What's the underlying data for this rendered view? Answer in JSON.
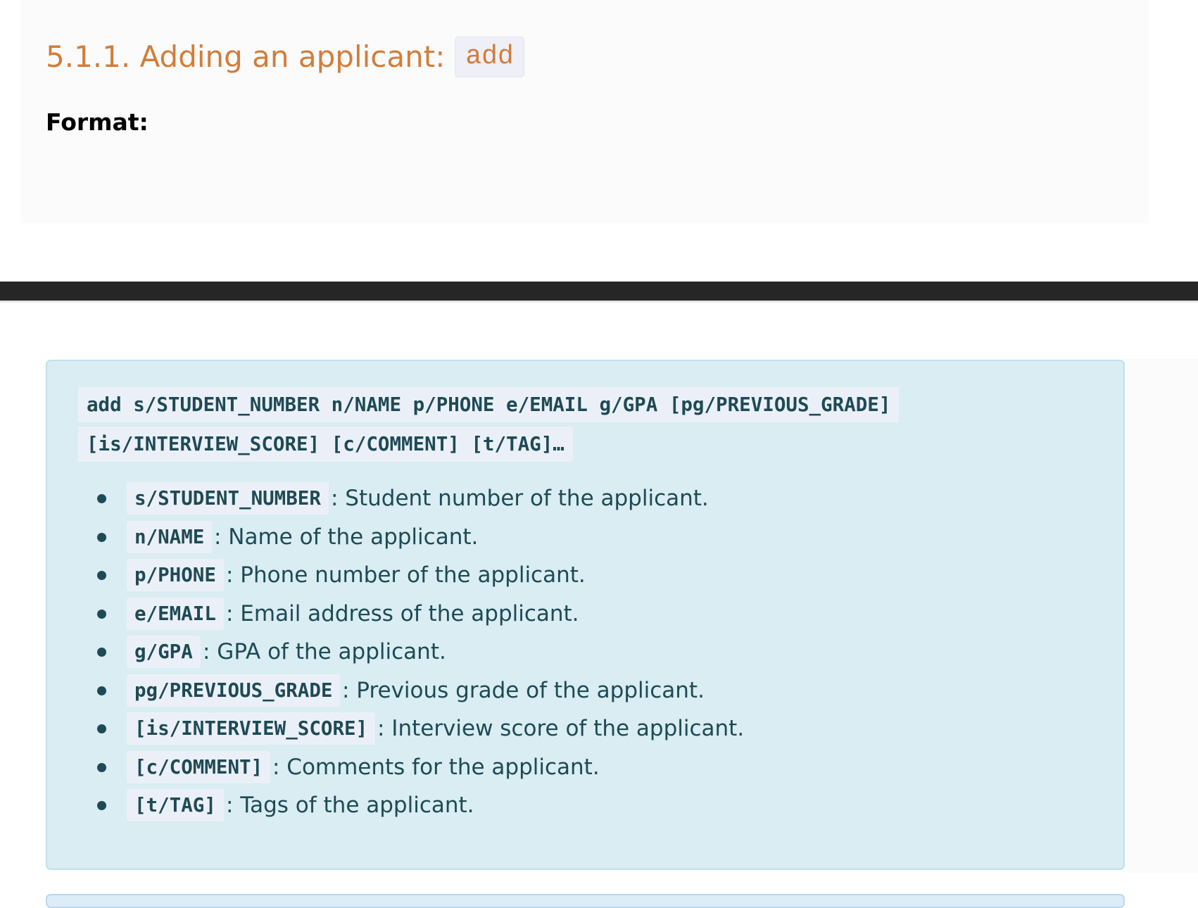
{
  "section": {
    "heading": "5.1.1. Adding an applicant:",
    "command": "add",
    "format_label": "Format:"
  },
  "format_box": {
    "command_line_1": "add s/STUDENT_NUMBER n/NAME p/PHONE e/EMAIL g/GPA [pg/PREVIOUS_GRADE]",
    "command_line_2": "[is/INTERVIEW_SCORE] [c/COMMENT] [t/TAG]…",
    "params": [
      {
        "code": "s/STUDENT_NUMBER",
        "desc": ": Student number of the applicant."
      },
      {
        "code": "n/NAME",
        "desc": ": Name of the applicant."
      },
      {
        "code": "p/PHONE",
        "desc": ": Phone number of the applicant."
      },
      {
        "code": "e/EMAIL",
        "desc": ": Email address of the applicant."
      },
      {
        "code": "g/GPA",
        "desc": ": GPA of the applicant."
      },
      {
        "code": "pg/PREVIOUS_GRADE",
        "desc": ": Previous grade of the applicant."
      },
      {
        "code": "[is/INTERVIEW_SCORE]",
        "desc": ": Interview score of the applicant."
      },
      {
        "code": "[c/COMMENT]",
        "desc": ": Comments for the applicant."
      },
      {
        "code": "[t/TAG]",
        "desc": ": Tags of the applicant."
      }
    ]
  },
  "colors": {
    "heading": "#d27d3a",
    "info_box_bg": "#d9edf2",
    "info_text": "#1e4a55",
    "code_bg": "#ebf0f8",
    "divider": "#262626"
  }
}
